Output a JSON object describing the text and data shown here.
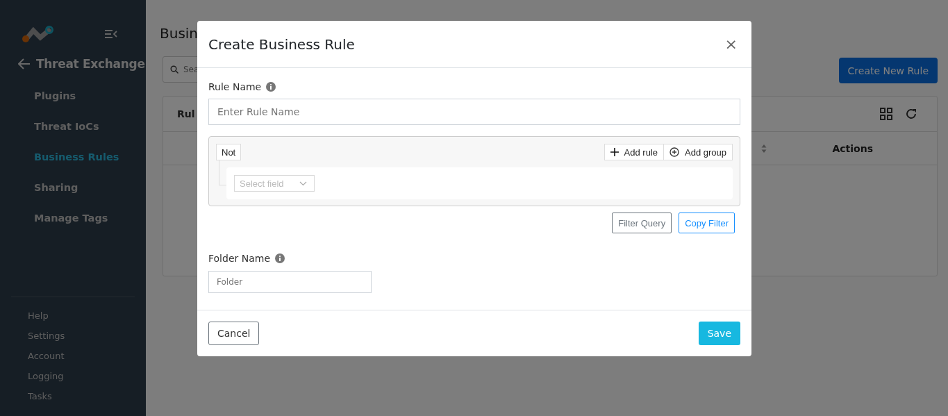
{
  "sidebar": {
    "back_title": "Threat Exchange",
    "items": [
      {
        "label": "Plugins",
        "selected": false
      },
      {
        "label": "Threat IoCs",
        "selected": false
      },
      {
        "label": "Business Rules",
        "selected": true
      },
      {
        "label": "Sharing",
        "selected": false
      },
      {
        "label": "Manage Tags",
        "selected": false
      }
    ],
    "footer_items": [
      "Help",
      "Settings",
      "Account",
      "Logging",
      "Tasks"
    ]
  },
  "page": {
    "title": "Busin",
    "search": {
      "placeholder": "Sea"
    },
    "create_button": "Create New Rule",
    "table": {
      "toolbar_label": "Rul",
      "columns": [
        {
          "label": "Actions"
        }
      ]
    }
  },
  "modal": {
    "title": "Create Business Rule",
    "close": "×",
    "rule_name": {
      "label": "Rule Name",
      "placeholder": "Enter Rule Name"
    },
    "query_builder": {
      "not_button": "Not",
      "not_selected": false,
      "add_rule": "Add rule",
      "add_group": "Add group",
      "field_select": {
        "placeholder": "Select field"
      }
    },
    "query_buttons": [
      {
        "label": "Filter Query",
        "kind": "plain"
      },
      {
        "label": "Copy Filter",
        "kind": "accent"
      }
    ],
    "folder_name": {
      "label": "Folder Name",
      "placeholder": "Folder"
    },
    "cancel_button": "Cancel",
    "save_button": "Save"
  }
}
